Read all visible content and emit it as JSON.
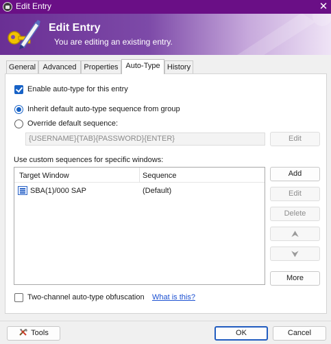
{
  "window": {
    "title": "Edit Entry",
    "close_glyph": "✕"
  },
  "banner": {
    "title": "Edit Entry",
    "subtitle": "You are editing an existing entry."
  },
  "tabs": [
    {
      "label": "General"
    },
    {
      "label": "Advanced"
    },
    {
      "label": "Properties"
    },
    {
      "label": "Auto-Type",
      "active": true
    },
    {
      "label": "History"
    }
  ],
  "autotype": {
    "enable_label": "Enable auto-type for this entry",
    "enable_checked": true,
    "inherit_label": "Inherit default auto-type sequence from group",
    "override_label": "Override default sequence:",
    "selected_mode": "inherit",
    "sequence_value": "{USERNAME}{TAB}{PASSWORD}{ENTER}",
    "edit_button": "Edit",
    "custom_label": "Use custom sequences for specific windows:",
    "columns": [
      "Target Window",
      "Sequence"
    ],
    "rows": [
      {
        "window": "SBA(1)/000 SAP",
        "sequence": "(Default)",
        "icon": "list-icon"
      }
    ],
    "buttons": {
      "add": "Add",
      "edit": "Edit",
      "delete": "Delete",
      "up": "⮝",
      "down": "⮟",
      "more": "More"
    },
    "obfuscation_label": "Two-channel auto-type obfuscation",
    "obfuscation_checked": false,
    "what_is_this": "What is this?"
  },
  "footer": {
    "tools": "Tools",
    "ok": "OK",
    "cancel": "Cancel"
  },
  "colors": {
    "titlebar": "#6a0f86",
    "accent": "#1762c6",
    "link": "#1a4fd1"
  }
}
